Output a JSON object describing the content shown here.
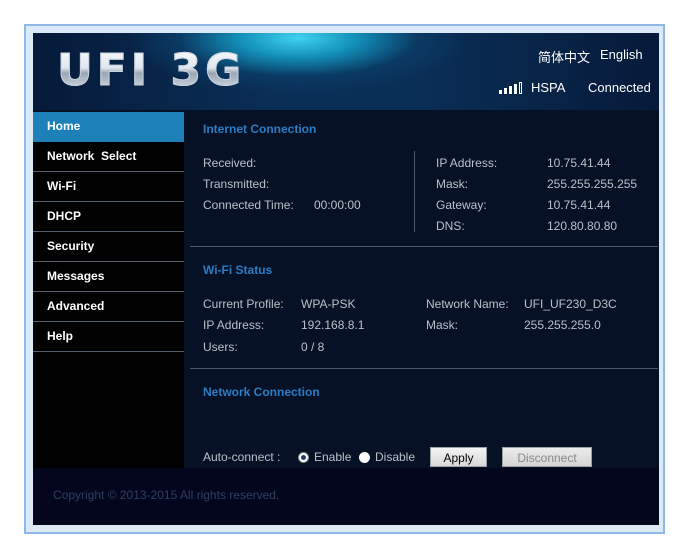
{
  "header": {
    "logo": "UFI 3G",
    "lang_cn": "简体中文",
    "lang_en": "English",
    "network_type": "HSPA",
    "status": "Connected",
    "signal_bars": 4
  },
  "sidebar": {
    "items": [
      {
        "label": "Home",
        "active": true
      },
      {
        "label": "Network  Select",
        "active": false
      },
      {
        "label": "Wi-Fi",
        "active": false
      },
      {
        "label": "DHCP",
        "active": false
      },
      {
        "label": "Security",
        "active": false
      },
      {
        "label": "Messages",
        "active": false
      },
      {
        "label": "Advanced",
        "active": false
      },
      {
        "label": "Help",
        "active": false
      }
    ]
  },
  "internet": {
    "title": "Internet Connection",
    "received_label": "Received:",
    "transmitted_label": "Transmitted:",
    "connected_time_label": "Connected Time:",
    "connected_time": "00:00:00",
    "ip_label": "IP Address:",
    "ip": "10.75.41.44",
    "mask_label": "Mask:",
    "mask": "255.255.255.255",
    "gateway_label": "Gateway:",
    "gateway": "10.75.41.44",
    "dns_label": "DNS:",
    "dns": "120.80.80.80"
  },
  "wifi": {
    "title": "Wi-Fi Status",
    "profile_label": "Current Profile:",
    "profile": "WPA-PSK",
    "ip_label": "IP Address:",
    "ip": "192.168.8.1",
    "users_label": "Users:",
    "users": "0 / 8",
    "network_name_label": "Network Name:",
    "network_name": "UFI_UF230_D3C",
    "mask_label": "Mask:",
    "mask": "255.255.255.0"
  },
  "network_connection": {
    "title": "Network Connection",
    "autoconnect_label": "Auto-connect :",
    "enable_label": "Enable",
    "disable_label": "Disable",
    "selected": "Enable",
    "apply_label": "Apply",
    "disconnect_label": "Disconnect"
  },
  "footer": {
    "copyright": "Copyright © 2013-2015 All rights reserved."
  },
  "colors": {
    "accent": "#1d80b8",
    "section_title": "#2a7cc4",
    "background": "#061126"
  }
}
